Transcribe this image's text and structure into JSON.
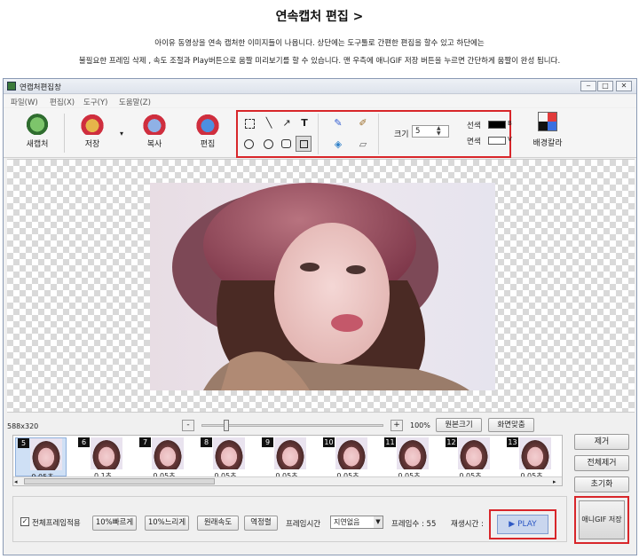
{
  "header": {
    "title": "연속캡처 편집 >",
    "line1": "아이유 동영상을 연속 캡처한 이미지들이 나옵니다.  상단에는 도구툴로 간편한 편집을 할수 있고  하단에는",
    "line2": "불필요한 프레임 삭제 , 속도 조절과  Play버튼으로 움짤 미리보기를 할 수 있습니다. 맨 우측에  애니GIF 저장 버튼을 누르면 간단하게 움짤이 완성 됩니다."
  },
  "window": {
    "title": "연캡처편집창",
    "controls": [
      "‒",
      "□",
      "✕"
    ]
  },
  "menu": [
    "파일(W)",
    "편집(X)",
    "도구(Y)",
    "도움말(Z)"
  ],
  "toolbar": {
    "new_capture": "새캡처",
    "save": "저장",
    "copy": "복사",
    "edit": "편집",
    "size_label": "크기",
    "size_value": "5",
    "line_label": "선색",
    "line_value": "B",
    "fill_label": "면색",
    "fill_value": "V",
    "bg_color": "배경칼라"
  },
  "status": {
    "dimensions": "588x320",
    "minus": "-",
    "plus": "+",
    "zoom": "100%",
    "original_size": "원본크기",
    "fit_screen": "화면맞춤",
    "slider_level": 0.12
  },
  "frames": [
    {
      "num": "5",
      "dur": "0.05초"
    },
    {
      "num": "6",
      "dur": "0.1초"
    },
    {
      "num": "7",
      "dur": "0.05초"
    },
    {
      "num": "8",
      "dur": "0.05초"
    },
    {
      "num": "9",
      "dur": "0.05초"
    },
    {
      "num": "10",
      "dur": "0.05초"
    },
    {
      "num": "11",
      "dur": "0.05초"
    },
    {
      "num": "12",
      "dur": "0.05초"
    },
    {
      "num": "13",
      "dur": "0.05초"
    }
  ],
  "side": {
    "remove": "제거",
    "remove_all": "전체제거",
    "reset": "초기화"
  },
  "bottom": {
    "apply_all": "전체프레임적용",
    "faster": "10%빠르게",
    "slower": "10%느리게",
    "original_speed": "원래속도",
    "reverse": "역정렬",
    "frame_time_label": "프레임시간",
    "frame_time_value": "지연없음",
    "frame_count": "프레임수 :  55",
    "play_time": "재생시간 :",
    "play": "▶ PLAY",
    "save_gif": "애니GIF 저장"
  },
  "colors": {
    "highlight": "#d8262a",
    "play_bg": "#c9d6ee"
  }
}
